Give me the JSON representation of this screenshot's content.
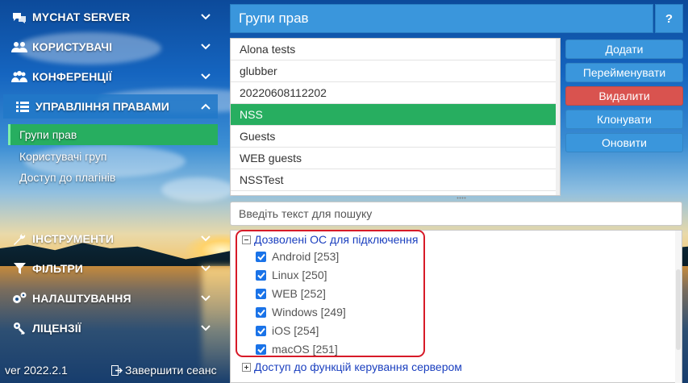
{
  "sidebar": {
    "items": [
      {
        "label": "MYCHAT SERVER",
        "icon": "chat-bubbles-icon"
      },
      {
        "label": "КОРИСТУВАЧІ",
        "icon": "users-icon"
      },
      {
        "label": "КОНФЕРЕНЦІЇ",
        "icon": "conferences-icon"
      },
      {
        "label": "УПРАВЛІННЯ ПРАВАМИ",
        "icon": "list-icon",
        "expanded": true
      },
      {
        "label": "ІНСТРУМЕНТИ",
        "icon": "wrench-icon"
      },
      {
        "label": "ФІЛЬТРИ",
        "icon": "filter-icon"
      },
      {
        "label": "НАЛАШТУВАННЯ",
        "icon": "gears-icon"
      },
      {
        "label": "ЛІЦЕНЗІЇ",
        "icon": "key-icon"
      }
    ],
    "sub_items": [
      "Групи прав",
      "Користувачі груп",
      "Доступ до плагінів"
    ],
    "active_sub": "Групи прав",
    "version": "ver 2022.2.1",
    "logout": "Завершити сеанс"
  },
  "header": {
    "title": "Групи прав",
    "help": "?"
  },
  "groups": [
    "Alona tests",
    "glubber",
    "20220608112202",
    "NSS",
    "Guests",
    "WEB guests",
    "NSSTest"
  ],
  "selected_group": "NSS",
  "actions": {
    "add": "Додати",
    "rename": "Перейменувати",
    "delete": "Видалити",
    "clone": "Клонувати",
    "refresh": "Оновити"
  },
  "search": {
    "placeholder": "Введіть текст для пошуку"
  },
  "tree": {
    "os_group": {
      "label": "Дозволені ОС для підключення",
      "expanded": true,
      "items": [
        {
          "label": "Android [253]",
          "checked": true
        },
        {
          "label": "Linux [250]",
          "checked": true
        },
        {
          "label": "WEB [252]",
          "checked": true
        },
        {
          "label": "Windows [249]",
          "checked": true
        },
        {
          "label": "iOS [254]",
          "checked": true
        },
        {
          "label": "macOS [251]",
          "checked": true
        }
      ]
    },
    "server_group": {
      "label": "Доступ до функцій керування сервером",
      "expanded": false
    }
  },
  "colors": {
    "accent": "#3a96dc",
    "selected": "#27ae60",
    "danger": "#d9534f",
    "highlight": "#d71a28",
    "link": "#1a3fbf"
  }
}
